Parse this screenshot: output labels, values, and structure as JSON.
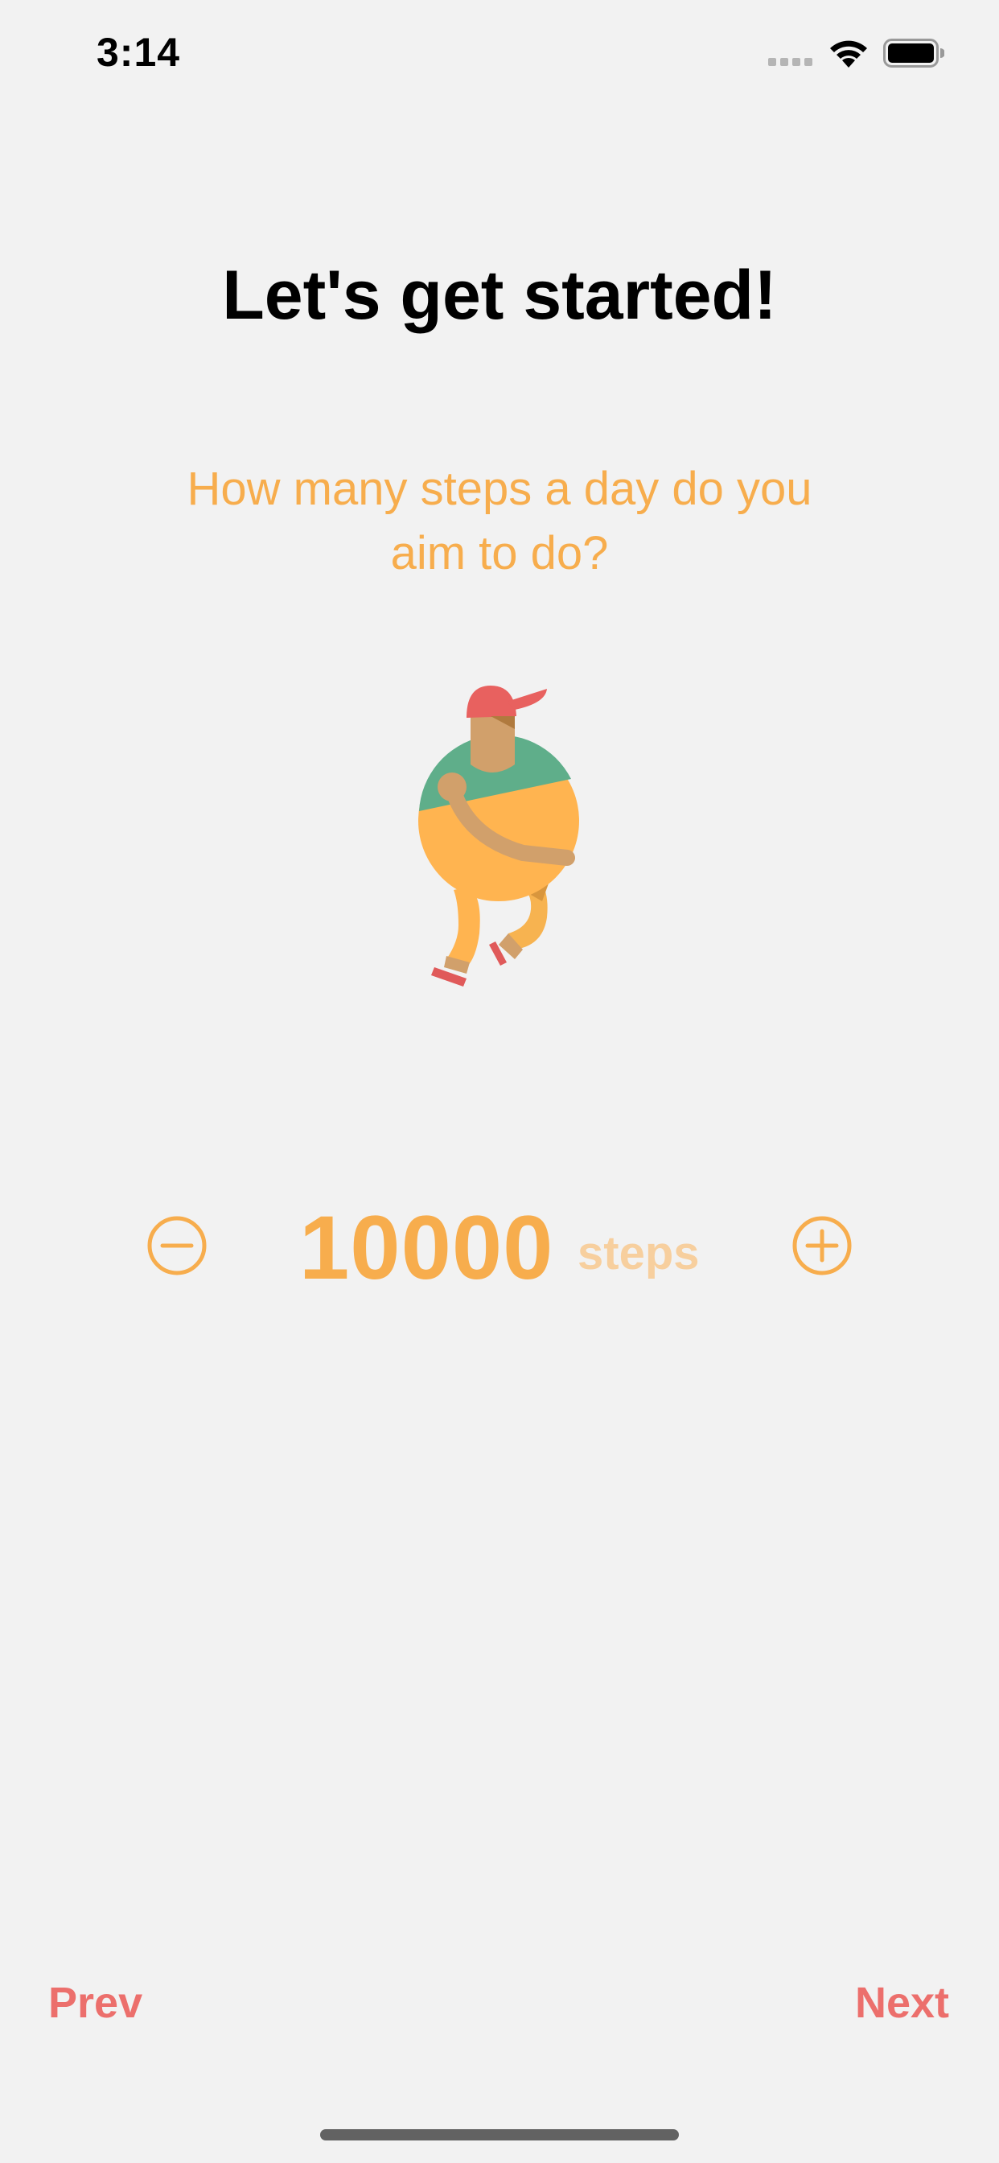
{
  "status_bar": {
    "time": "3:14"
  },
  "onboarding": {
    "title": "Let's get started!",
    "question": "How many steps a day do you aim to do?",
    "illustration": "running-person-illustration"
  },
  "stepper": {
    "value": "10000",
    "unit": "steps",
    "decrement_icon": "minus-circle-icon",
    "increment_icon": "plus-circle-icon"
  },
  "navigation": {
    "prev_label": "Prev",
    "next_label": "Next"
  },
  "colors": {
    "accent_orange": "#f7ad4d",
    "unit_orange_light": "#f7cf9e",
    "nav_red": "#ec6f6c",
    "background": "#f2f2f2"
  }
}
